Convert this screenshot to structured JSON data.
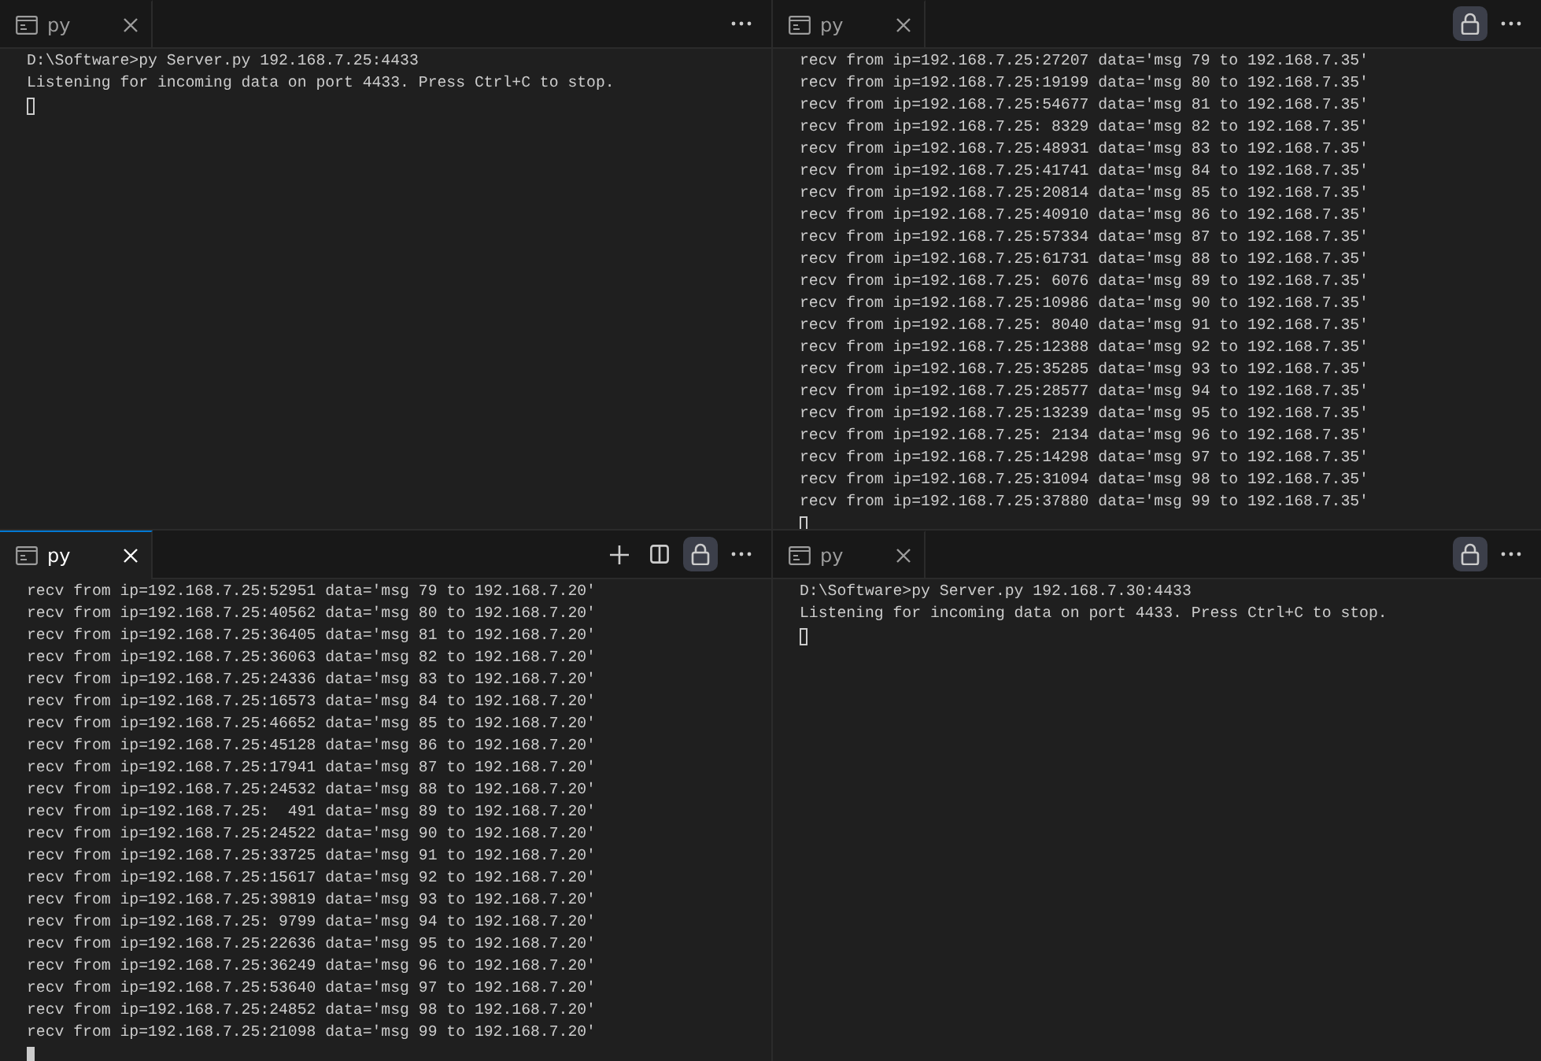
{
  "panes": [
    {
      "tab": {
        "label": "py",
        "selected": false
      },
      "actions": [
        {
          "kind": "more",
          "on": false
        }
      ],
      "lines": [
        "D:\\Software>py Server.py 192.168.7.25:4433",
        "Listening for incoming data on port 4433. Press Ctrl+C to stop."
      ]
    },
    {
      "tab": {
        "label": "py",
        "selected": false
      },
      "actions": [
        {
          "kind": "lock",
          "on": true
        },
        {
          "kind": "more",
          "on": false
        }
      ],
      "lines": [
        "recv from ip=192.168.7.25:27207 data='msg 79 to 192.168.7.35'",
        "recv from ip=192.168.7.25:19199 data='msg 80 to 192.168.7.35'",
        "recv from ip=192.168.7.25:54677 data='msg 81 to 192.168.7.35'",
        "recv from ip=192.168.7.25: 8329 data='msg 82 to 192.168.7.35'",
        "recv from ip=192.168.7.25:48931 data='msg 83 to 192.168.7.35'",
        "recv from ip=192.168.7.25:41741 data='msg 84 to 192.168.7.35'",
        "recv from ip=192.168.7.25:20814 data='msg 85 to 192.168.7.35'",
        "recv from ip=192.168.7.25:40910 data='msg 86 to 192.168.7.35'",
        "recv from ip=192.168.7.25:57334 data='msg 87 to 192.168.7.35'",
        "recv from ip=192.168.7.25:61731 data='msg 88 to 192.168.7.35'",
        "recv from ip=192.168.7.25: 6076 data='msg 89 to 192.168.7.35'",
        "recv from ip=192.168.7.25:10986 data='msg 90 to 192.168.7.35'",
        "recv from ip=192.168.7.25: 8040 data='msg 91 to 192.168.7.35'",
        "recv from ip=192.168.7.25:12388 data='msg 92 to 192.168.7.35'",
        "recv from ip=192.168.7.25:35285 data='msg 93 to 192.168.7.35'",
        "recv from ip=192.168.7.25:28577 data='msg 94 to 192.168.7.35'",
        "recv from ip=192.168.7.25:13239 data='msg 95 to 192.168.7.35'",
        "recv from ip=192.168.7.25: 2134 data='msg 96 to 192.168.7.35'",
        "recv from ip=192.168.7.25:14298 data='msg 97 to 192.168.7.35'",
        "recv from ip=192.168.7.25:31094 data='msg 98 to 192.168.7.35'",
        "recv from ip=192.168.7.25:37880 data='msg 99 to 192.168.7.35'"
      ]
    },
    {
      "tab": {
        "label": "py",
        "selected": true
      },
      "actions": [
        {
          "kind": "add",
          "on": false
        },
        {
          "kind": "split",
          "on": false
        },
        {
          "kind": "lock",
          "on": true
        },
        {
          "kind": "more",
          "on": false
        }
      ],
      "lines": [
        "recv from ip=192.168.7.25:52951 data='msg 79 to 192.168.7.20'",
        "recv from ip=192.168.7.25:40562 data='msg 80 to 192.168.7.20'",
        "recv from ip=192.168.7.25:36405 data='msg 81 to 192.168.7.20'",
        "recv from ip=192.168.7.25:36063 data='msg 82 to 192.168.7.20'",
        "recv from ip=192.168.7.25:24336 data='msg 83 to 192.168.7.20'",
        "recv from ip=192.168.7.25:16573 data='msg 84 to 192.168.7.20'",
        "recv from ip=192.168.7.25:46652 data='msg 85 to 192.168.7.20'",
        "recv from ip=192.168.7.25:45128 data='msg 86 to 192.168.7.20'",
        "recv from ip=192.168.7.25:17941 data='msg 87 to 192.168.7.20'",
        "recv from ip=192.168.7.25:24532 data='msg 88 to 192.168.7.20'",
        "recv from ip=192.168.7.25:  491 data='msg 89 to 192.168.7.20'",
        "recv from ip=192.168.7.25:24522 data='msg 90 to 192.168.7.20'",
        "recv from ip=192.168.7.25:33725 data='msg 91 to 192.168.7.20'",
        "recv from ip=192.168.7.25:15617 data='msg 92 to 192.168.7.20'",
        "recv from ip=192.168.7.25:39819 data='msg 93 to 192.168.7.20'",
        "recv from ip=192.168.7.25: 9799 data='msg 94 to 192.168.7.20'",
        "recv from ip=192.168.7.25:22636 data='msg 95 to 192.168.7.20'",
        "recv from ip=192.168.7.25:36249 data='msg 96 to 192.168.7.20'",
        "recv from ip=192.168.7.25:53640 data='msg 97 to 192.168.7.20'",
        "recv from ip=192.168.7.25:24852 data='msg 98 to 192.168.7.20'",
        "recv from ip=192.168.7.25:21098 data='msg 99 to 192.168.7.20'"
      ]
    },
    {
      "tab": {
        "label": "py",
        "selected": false
      },
      "actions": [
        {
          "kind": "lock",
          "on": true
        },
        {
          "kind": "more",
          "on": false
        }
      ],
      "lines": [
        "D:\\Software>py Server.py 192.168.7.30:4433",
        "Listening for incoming data on port 4433. Press Ctrl+C to stop."
      ]
    }
  ]
}
